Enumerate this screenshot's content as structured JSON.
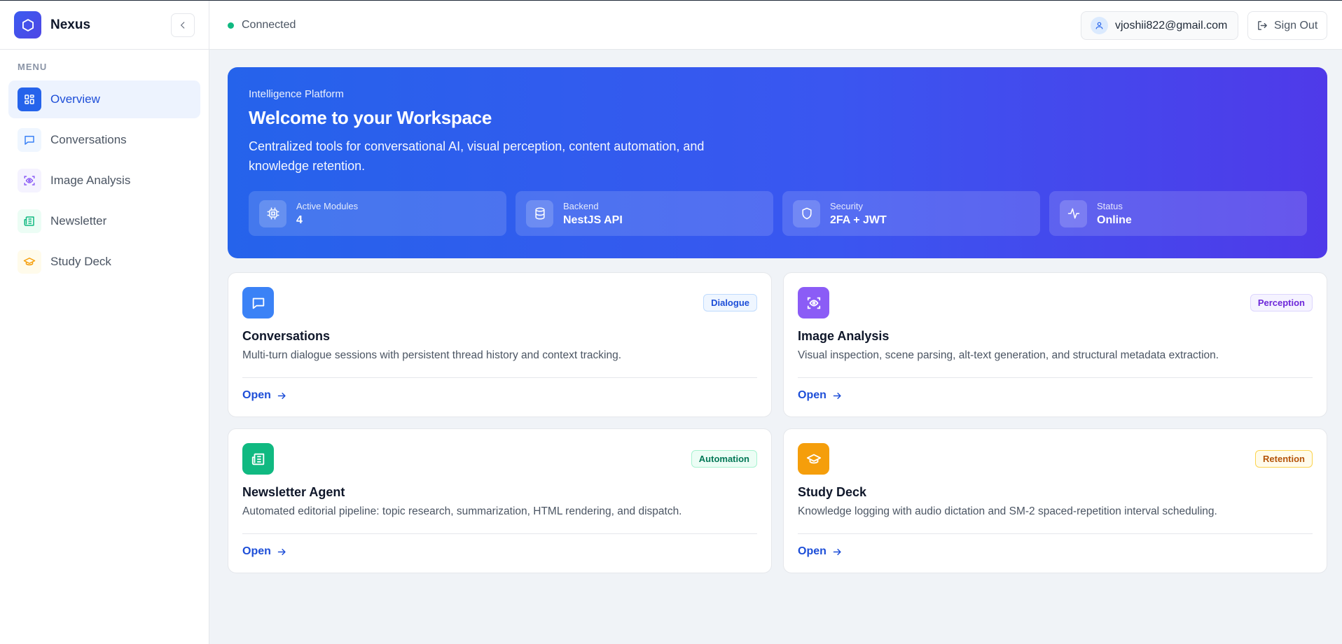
{
  "app": {
    "name": "Nexus"
  },
  "sidebar": {
    "menu_label": "MENU",
    "items": [
      {
        "label": "Overview",
        "icon": "grid-icon",
        "active": true
      },
      {
        "label": "Conversations",
        "icon": "message-square-icon"
      },
      {
        "label": "Image Analysis",
        "icon": "scan-eye-icon"
      },
      {
        "label": "Newsletter",
        "icon": "newspaper-icon"
      },
      {
        "label": "Study Deck",
        "icon": "graduation-cap-icon"
      }
    ]
  },
  "topbar": {
    "status": "Connected",
    "user_email": "vjoshii822@gmail.com",
    "sign_out_label": "Sign Out"
  },
  "hero": {
    "eyebrow": "Intelligence Platform",
    "title": "Welcome to your Workspace",
    "description": "Centralized tools for conversational AI, visual perception, content automation, and knowledge retention.",
    "stats": [
      {
        "label": "Active Modules",
        "value": "4",
        "icon": "cpu-icon"
      },
      {
        "label": "Backend",
        "value": "NestJS API",
        "icon": "database-icon"
      },
      {
        "label": "Security",
        "value": "2FA + JWT",
        "icon": "shield-icon"
      },
      {
        "label": "Status",
        "value": "Online",
        "icon": "activity-icon"
      }
    ]
  },
  "cards": [
    {
      "title": "Conversations",
      "badge": "Dialogue",
      "description": "Multi-turn dialogue sessions with persistent thread history and context tracking.",
      "link": "Open",
      "icon": "message-square-icon"
    },
    {
      "title": "Image Analysis",
      "badge": "Perception",
      "description": "Visual inspection, scene parsing, alt-text generation, and structural metadata extraction.",
      "link": "Open",
      "icon": "scan-eye-icon"
    },
    {
      "title": "Newsletter Agent",
      "badge": "Automation",
      "description": "Automated editorial pipeline: topic research, summarization, HTML rendering, and dispatch.",
      "link": "Open",
      "icon": "newspaper-icon"
    },
    {
      "title": "Study Deck",
      "badge": "Retention",
      "description": "Knowledge logging with audio dictation and SM-2 spaced-repetition interval scheduling.",
      "link": "Open",
      "icon": "graduation-cap-icon"
    }
  ],
  "colors": {
    "accent": "#2563eb",
    "conversations": "#3b82f6",
    "image_analysis": "#8b5cf6",
    "newsletter": "#10b981",
    "study_deck": "#f59e0b",
    "status_online": "#10b981"
  }
}
